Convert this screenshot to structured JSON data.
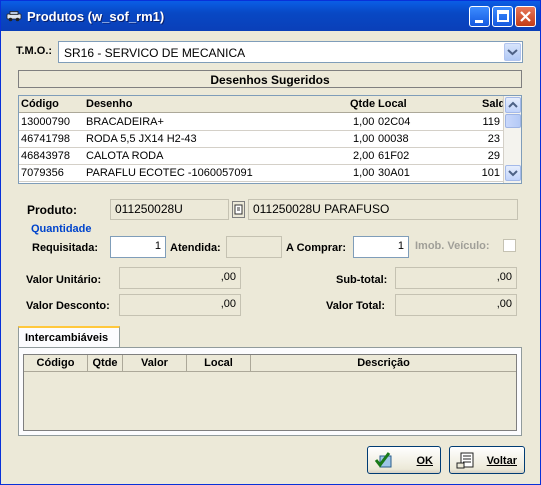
{
  "window": {
    "title": "Produtos (w_sof_rm1)"
  },
  "tmo": {
    "label": "T.M.O.:",
    "value": "SR16 - SERVICO DE MECANICA"
  },
  "section": {
    "title": "Desenhos Sugeridos"
  },
  "grid": {
    "headers": [
      "Código",
      "Desenho",
      "Qtde",
      "Local",
      "Saldo"
    ],
    "rows": [
      {
        "codigo": "13000790",
        "desenho": "BRACADEIRA+",
        "qtde": "1,00",
        "local": "02C04",
        "saldo": "119"
      },
      {
        "codigo": "46741798",
        "desenho": "RODA 5,5 JX14 H2-43",
        "qtde": "1,00",
        "local": "00038",
        "saldo": "23"
      },
      {
        "codigo": "46843978",
        "desenho": "CALOTA RODA",
        "qtde": "2,00",
        "local": "61F02",
        "saldo": "29"
      },
      {
        "codigo": "7079356",
        "desenho": "PARAFLU ECOTEC -1060057091",
        "qtde": "1,00",
        "local": "30A01",
        "saldo": "101"
      }
    ]
  },
  "produto": {
    "label": "Produto:",
    "code": "011250028U",
    "description": "011250028U PARAFUSO"
  },
  "quantidade": {
    "label": "Quantidade",
    "requisitada_label": "Requisitada:",
    "requisitada": "1",
    "atendida_label": "Atendida:",
    "atendida": "",
    "a_comprar_label": "A Comprar:",
    "a_comprar": "1",
    "imob_label": "Imob. Veículo:"
  },
  "valores": {
    "unitario_label": "Valor Unitário:",
    "unitario": ",00",
    "desconto_label": "Valor Desconto:",
    "desconto": ",00",
    "subtotal_label": "Sub-total:",
    "subtotal": ",00",
    "total_label": "Valor Total:",
    "total": ",00"
  },
  "tab": {
    "label": "Intercambiáveis",
    "headers": [
      "Código",
      "Qtde",
      "Valor",
      "Local",
      "Descrição"
    ]
  },
  "buttons": {
    "ok": "OK",
    "voltar": "Voltar"
  },
  "colors": {
    "title_bar": "#0848c4",
    "accent_blue": "#0044cc",
    "tab_highlight": "#ffc83c"
  }
}
